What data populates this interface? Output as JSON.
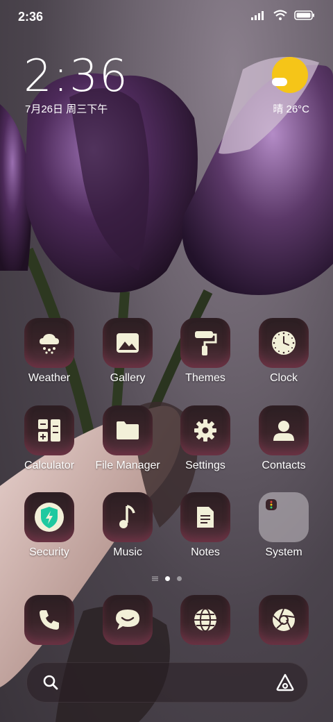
{
  "status_bar": {
    "time": "2:36"
  },
  "clock_widget": {
    "time": "2:36",
    "date": "7月26日 周三下午"
  },
  "weather_widget": {
    "text": "晴 26°C"
  },
  "apps_row1": [
    {
      "label": "Weather",
      "icon": "weather-icon"
    },
    {
      "label": "Gallery",
      "icon": "gallery-icon"
    },
    {
      "label": "Themes",
      "icon": "themes-icon"
    },
    {
      "label": "Clock",
      "icon": "clock-icon"
    }
  ],
  "apps_row2": [
    {
      "label": "Calculator",
      "icon": "calculator-icon"
    },
    {
      "label": "File Manager",
      "icon": "folder-icon"
    },
    {
      "label": "Settings",
      "icon": "gear-icon"
    },
    {
      "label": "Contacts",
      "icon": "contacts-icon"
    }
  ],
  "apps_row3": [
    {
      "label": "Security",
      "icon": "shield-icon"
    },
    {
      "label": "Music",
      "icon": "music-icon"
    },
    {
      "label": "Notes",
      "icon": "notes-icon"
    },
    {
      "label": "System",
      "icon": "folder-icon"
    }
  ],
  "dock": [
    {
      "icon": "phone-icon"
    },
    {
      "icon": "message-icon"
    },
    {
      "icon": "browser-icon"
    },
    {
      "icon": "camera-icon"
    }
  ],
  "colors": {
    "icon_glyph": "#f2f0d8",
    "sun": "#f5c518",
    "security_green": "#1fc9a0"
  }
}
